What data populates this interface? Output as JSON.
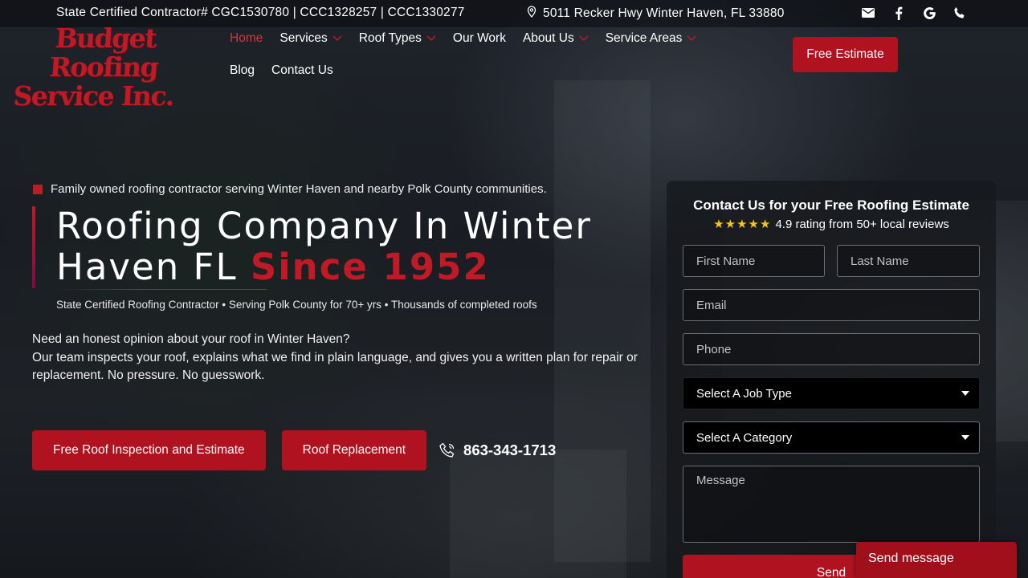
{
  "topbar": {
    "license": "State Certified Contractor# CGC1530780 | CCC1328257 | CCC1330277",
    "address": "5011 Recker Hwy Winter Haven, FL 33880",
    "icons": [
      "envelope-icon",
      "facebook-icon",
      "google-icon",
      "phone-icon"
    ]
  },
  "logo": {
    "line1": "Budget Roofing",
    "line2": "Service Inc."
  },
  "nav": {
    "row1": [
      {
        "label": "Home",
        "active": true
      },
      {
        "label": "Services",
        "dropdown": true
      },
      {
        "label": "Roof Types",
        "dropdown": true
      },
      {
        "label": "Our Work"
      },
      {
        "label": "About Us",
        "dropdown": true
      },
      {
        "label": "Service Areas",
        "dropdown": true
      }
    ],
    "row2": [
      {
        "label": "Blog"
      },
      {
        "label": "Contact Us"
      }
    ],
    "estimate_label": "Free Estimate"
  },
  "hero": {
    "tagline": "Family owned roofing contractor serving Winter Haven and nearby Polk County communities.",
    "title_main": "Roofing Company In Winter Haven FL ",
    "title_accent": "Since 1952",
    "stats": "State Certified Roofing Contractor • Serving Polk County for 70+ yrs • Thousands of completed roofs",
    "desc_line1": "Need an honest opinion about your roof in Winter Haven?",
    "desc_line2": "Our team inspects your roof, explains what we find in plain language, and gives you a written plan for repair or replacement. No pressure. No guesswork.",
    "cta_primary": "Free Roof Inspection and Estimate",
    "cta_secondary": "Roof Replacement",
    "phone": "863-343-1713"
  },
  "form": {
    "title": "Contact Us for your Free Roofing Estimate",
    "stars": "★★★★★",
    "rating_text": "4.9 rating from 50+ local reviews",
    "first_name_placeholder": "First Name",
    "last_name_placeholder": "Last Name",
    "email_placeholder": "Email",
    "phone_placeholder": "Phone",
    "job_type_selected": "Select A Job Type",
    "category_selected": "Select A Category",
    "message_placeholder": "Message",
    "send_label": "Send"
  },
  "chat": {
    "label": "Send message"
  },
  "colors": {
    "brand_red": "#b0121f",
    "accent_red": "#c01a26",
    "star_yellow": "#f5c518"
  }
}
